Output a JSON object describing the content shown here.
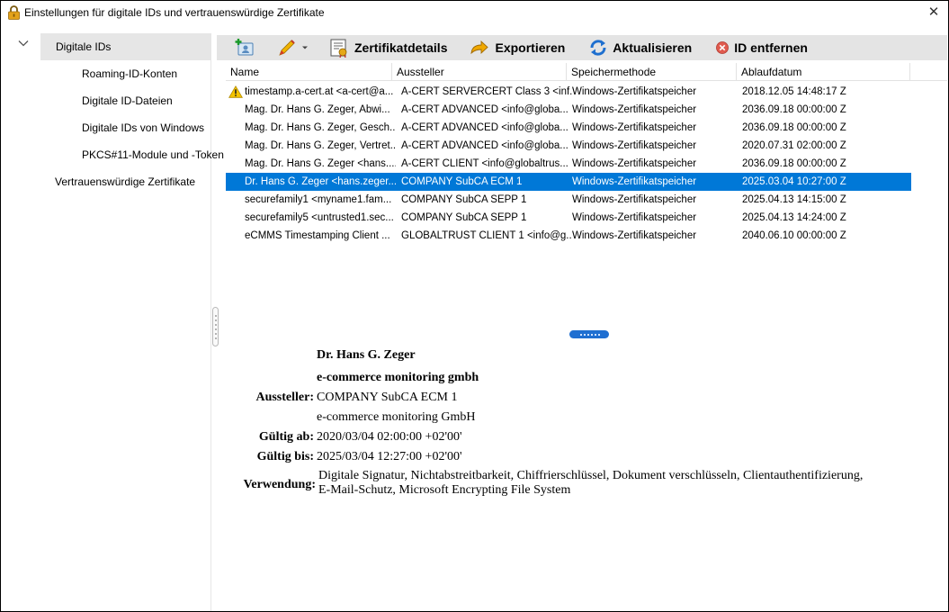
{
  "window": {
    "title": "Einstellungen für digitale IDs und vertrauenswürdige Zertifikate",
    "close_glyph": "✕"
  },
  "sidebar": {
    "items": [
      {
        "label": "Digitale IDs"
      },
      {
        "label": "Roaming-ID-Konten"
      },
      {
        "label": "Digitale ID-Dateien"
      },
      {
        "label": "Digitale IDs von Windows"
      },
      {
        "label": "PKCS#11-Module und -Token"
      },
      {
        "label": "Vertrauenswürdige Zertifikate"
      }
    ]
  },
  "toolbar": {
    "add_icon": "add-id-icon",
    "edit_icon": "pen-icon",
    "details_label": "Zertifikatdetails",
    "export_label": "Exportieren",
    "refresh_label": "Aktualisieren",
    "remove_label": "ID entfernen"
  },
  "table": {
    "columns": [
      "Name",
      "Aussteller",
      "Speichermethode",
      "Ablaufdatum"
    ],
    "rows": [
      {
        "name": "timestamp.a-cert.at <a-cert@a...",
        "issuer": "A-CERT SERVERCERT Class 3 <inf...",
        "storage": "Windows-Zertifikatspeicher",
        "expiry": "2018.12.05 14:48:17 Z",
        "warning": true
      },
      {
        "name": "Mag. Dr. Hans G.  Zeger, Abwi...",
        "issuer": "A-CERT ADVANCED <info@globa...",
        "storage": "Windows-Zertifikatspeicher",
        "expiry": "2036.09.18 00:00:00 Z"
      },
      {
        "name": "Mag. Dr. Hans G. Zeger, Gesch...",
        "issuer": "A-CERT ADVANCED <info@globa...",
        "storage": "Windows-Zertifikatspeicher",
        "expiry": "2036.09.18 00:00:00 Z"
      },
      {
        "name": "Mag. Dr. Hans G. Zeger, Vertret...",
        "issuer": "A-CERT ADVANCED <info@globa...",
        "storage": "Windows-Zertifikatspeicher",
        "expiry": "2020.07.31 02:00:00 Z"
      },
      {
        "name": "Mag. Dr. Hans G. Zeger <hans....",
        "issuer": "A-CERT CLIENT <info@globaltrus...",
        "storage": "Windows-Zertifikatspeicher",
        "expiry": "2036.09.18 00:00:00 Z"
      },
      {
        "name": "Dr. Hans G. Zeger <hans.zeger....",
        "issuer": "COMPANY SubCA ECM 1",
        "storage": "Windows-Zertifikatspeicher",
        "expiry": "2025.03.04 10:27:00 Z",
        "selected": true
      },
      {
        "name": "securefamily1 <myname1.fam...",
        "issuer": "COMPANY SubCA SEPP 1",
        "storage": "Windows-Zertifikatspeicher",
        "expiry": "2025.04.13 14:15:00 Z"
      },
      {
        "name": "securefamily5 <untrusted1.sec...",
        "issuer": "COMPANY SubCA SEPP 1",
        "storage": "Windows-Zertifikatspeicher",
        "expiry": "2025.04.13 14:24:00 Z"
      },
      {
        "name": "eCMMS Timestamping Client ...",
        "issuer": "GLOBALTRUST CLIENT 1 <info@g...",
        "storage": "Windows-Zertifikatspeicher",
        "expiry": "2040.06.10 00:00:00 Z"
      }
    ]
  },
  "details": {
    "subject_name": "Dr. Hans G. Zeger",
    "subject_org": "e-commerce monitoring gmbh",
    "issuer_label": "Aussteller:",
    "issuer_name": "COMPANY SubCA ECM 1",
    "issuer_org": "e-commerce monitoring GmbH",
    "valid_from_label": "Gültig ab:",
    "valid_from": "2020/03/04 02:00:00 +02'00'",
    "valid_to_label": "Gültig bis:",
    "valid_to": "2025/03/04 12:27:00 +02'00'",
    "usage_label": "Verwendung:",
    "usage_line1": "Digitale Signatur, Nichtabstreitbarkeit, Chiffrierschlüssel, Dokument verschlüsseln, Clientauthentifizierung,",
    "usage_line2": "E-Mail-Schutz, Microsoft Encrypting File System"
  },
  "colors": {
    "selection": "#0078d7",
    "toolbar_bg": "#e4e4e4",
    "sidebar_selected": "#e6e6e6"
  }
}
